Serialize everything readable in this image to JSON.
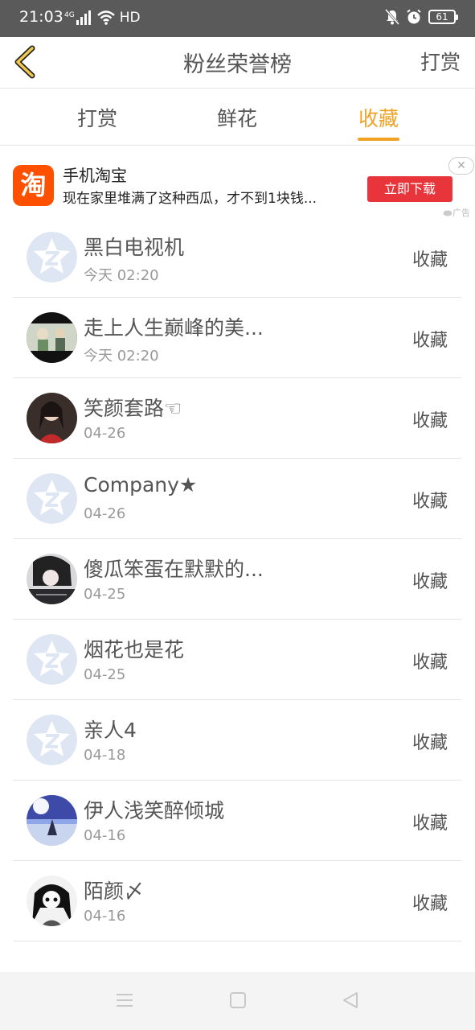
{
  "status_bar": {
    "time": "21:03",
    "network": "4G",
    "hd": "HD",
    "battery": "61"
  },
  "header": {
    "title": "粉丝荣誉榜",
    "right_label": "打赏"
  },
  "tabs": [
    {
      "label": "打赏",
      "active": false
    },
    {
      "label": "鲜花",
      "active": false
    },
    {
      "label": "收藏",
      "active": true
    }
  ],
  "ad": {
    "logo_char": "淘",
    "title": "手机淘宝",
    "description": "现在家里堆满了这种西瓜，才不到1块钱...",
    "button": "立即下载",
    "label": "广告"
  },
  "list": [
    {
      "name": "黑白电视机",
      "time": "今天 02:20",
      "action": "收藏",
      "avatar": "default"
    },
    {
      "name": "走上人生巅峰的美...",
      "time": "今天 02:20",
      "action": "收藏",
      "avatar": "photo"
    },
    {
      "name": "笑颜套路☜",
      "time": "04-26",
      "action": "收藏",
      "avatar": "photo"
    },
    {
      "name": "Company★",
      "time": "04-26",
      "action": "收藏",
      "avatar": "default"
    },
    {
      "name": "傻瓜笨蛋在默默的...",
      "time": "04-25",
      "action": "收藏",
      "avatar": "photo"
    },
    {
      "name": "烟花也是花",
      "time": "04-25",
      "action": "收藏",
      "avatar": "default"
    },
    {
      "name": "亲人4",
      "time": "04-18",
      "action": "收藏",
      "avatar": "default"
    },
    {
      "name": "伊人浅笑醉倾城",
      "time": "04-16",
      "action": "收藏",
      "avatar": "photo"
    },
    {
      "name": "陌颜〆",
      "time": "04-16",
      "action": "收藏",
      "avatar": "photo"
    }
  ],
  "colors": {
    "accent": "#f0a224",
    "ad_button": "#e8343b",
    "taobao": "#ff5000",
    "status_bar": "#5a5a5a"
  },
  "icons": {
    "back": "chevron-left-icon",
    "nav_menu": "menu-icon",
    "nav_home": "home-square-icon",
    "nav_back": "triangle-back-icon"
  }
}
